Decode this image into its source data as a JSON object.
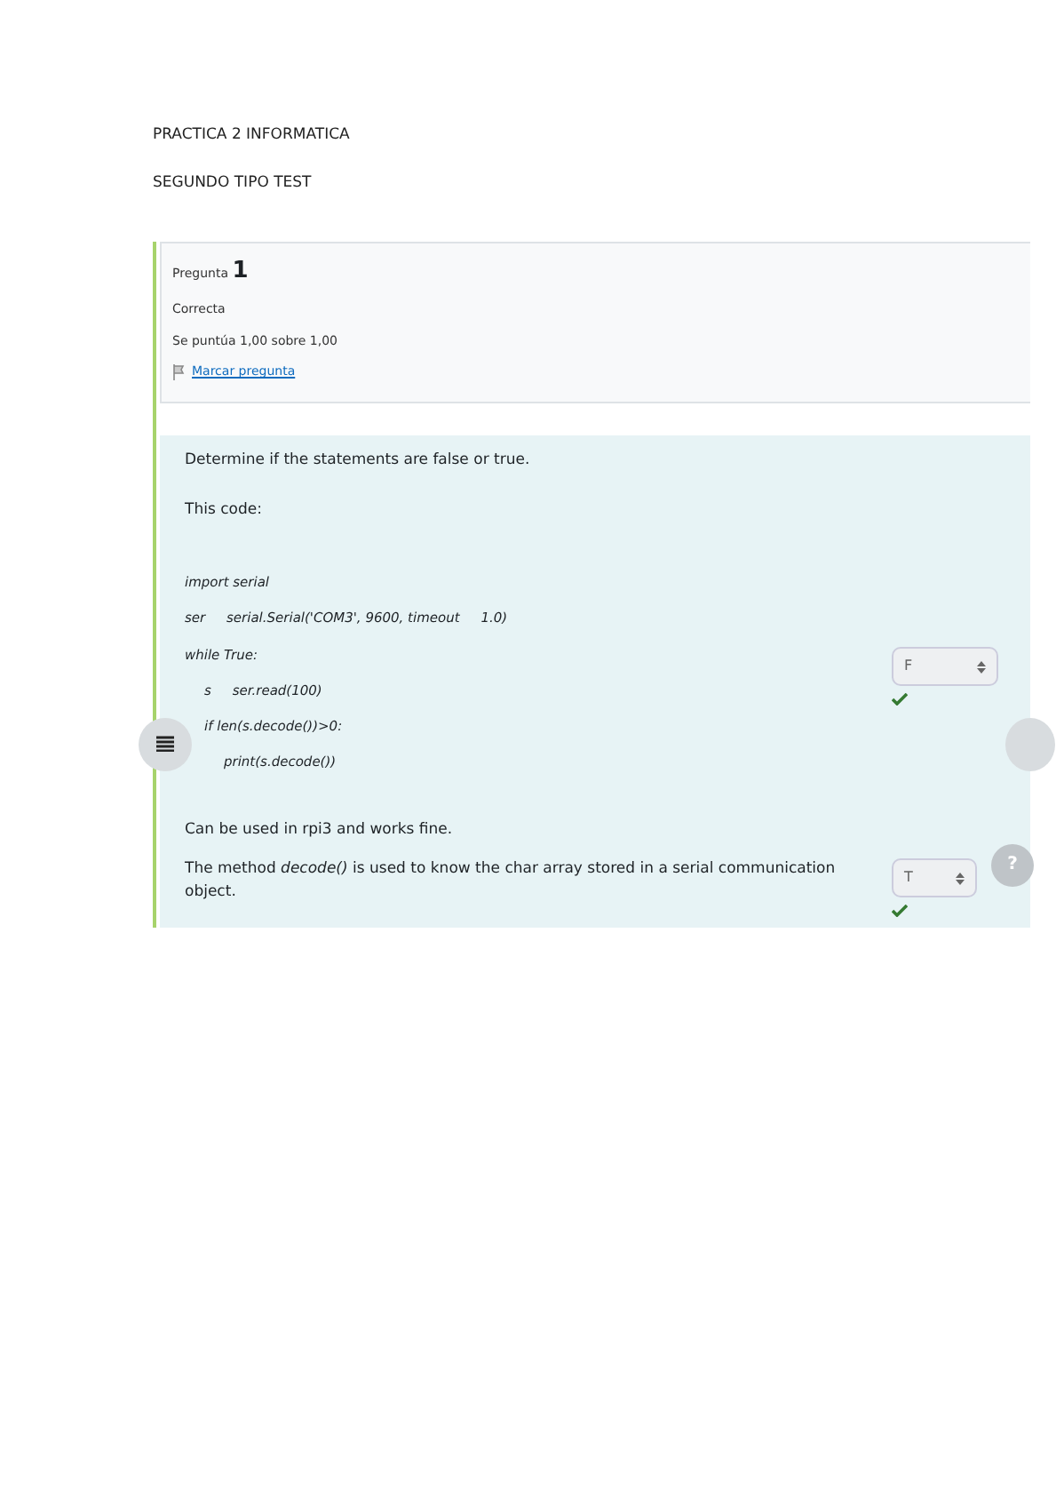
{
  "document_lines": [
    "PRACTICA 2 INFORMATICA",
    "SEGUNDO TIPO TEST"
  ],
  "question_info": {
    "label": "Pregunta",
    "number": "1",
    "state": "Correcta",
    "grade": "Se puntúa 1,00 sobre 1,00",
    "flag_link": "Marcar pregunta"
  },
  "help_button": "?",
  "question": {
    "prompt": "Determine if the statements are false or true.",
    "intro": "This code:",
    "code": [
      {
        "text": "import serial"
      },
      {
        "text": "ser     serial.Serial('COM3', 9600, timeout     1.0)"
      },
      {
        "text": "while True:",
        "children": [
          {
            "text": "s     ser.read(100)"
          },
          {
            "text": "if len(s.decode())>0:",
            "children": [
              {
                "text": "print(s.decode())"
              }
            ]
          }
        ]
      }
    ],
    "statements": [
      {
        "text": "Can be used in rpi3 and works fine.",
        "answer": "F",
        "correct": true
      },
      {
        "text": "The method *decode()* is used to know the char array stored in a serial communication object.",
        "answer": "T",
        "correct": true
      }
    ]
  }
}
